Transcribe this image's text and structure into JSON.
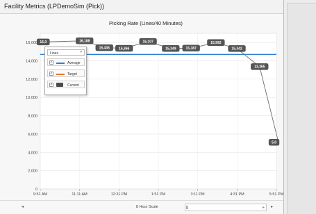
{
  "window": {
    "title": "Facility Metrics (LPDemoSim (Pick))"
  },
  "chart_data": {
    "type": "line",
    "title": "Picking Rate (Lines/40 Minutes)",
    "x_tick_labels": [
      "9:51 AM",
      "11:11 AM",
      "12:31 PM",
      "1:51 PM",
      "3:11 PM",
      "4:31 PM",
      "5:51 PM"
    ],
    "y_ticks": [
      0,
      2000,
      4000,
      6000,
      8000,
      10000,
      12000,
      14000,
      16000
    ],
    "y_tick_labels": [
      "0",
      "2,000",
      "4,000",
      "6,000",
      "8,000",
      "10,000",
      "12,000",
      "14,000",
      "16,000"
    ],
    "ylim": [
      0,
      17000
    ],
    "grid": true,
    "series": [
      {
        "name": "Current",
        "color": "#6b6b6b",
        "points": [
          {
            "x": 9.95,
            "y": 16060,
            "label": "16,0"
          },
          {
            "x": 11.35,
            "y": 16188,
            "label": "16,188"
          },
          {
            "x": 12.02,
            "y": 15436,
            "label": "15,436"
          },
          {
            "x": 12.69,
            "y": 15366,
            "label": "15,366"
          },
          {
            "x": 13.5,
            "y": 16107,
            "label": "16,107"
          },
          {
            "x": 14.27,
            "y": 15349,
            "label": "15,349"
          },
          {
            "x": 14.96,
            "y": 15387,
            "label": "15,387"
          },
          {
            "x": 15.8,
            "y": 15992,
            "label": "15,992"
          },
          {
            "x": 16.51,
            "y": 15342,
            "label": "15,342"
          },
          {
            "x": 17.28,
            "y": 13365,
            "label": "13,365"
          },
          {
            "x": 17.92,
            "y": 5100,
            "label": "5,0"
          }
        ]
      },
      {
        "name": "Average",
        "color": "#2e7fd0",
        "value": 14700
      },
      {
        "name": "Target",
        "color": "#e8762b"
      }
    ],
    "legend": {
      "dropdown": "Lines",
      "placement": "top-left",
      "items": [
        {
          "label": "Average",
          "color": "#2e7fd0",
          "checked": true
        },
        {
          "label": "Target",
          "color": "#e8762b",
          "checked": true
        },
        {
          "label": "Current",
          "color": "#4a4a4a",
          "checked": true
        }
      ]
    }
  },
  "footer": {
    "scale_label": "8 Hour Scale"
  },
  "icons": {
    "scroll_left": "◂",
    "scroll_right": "▸",
    "dropdown_caret": "▾",
    "check": "✓"
  }
}
